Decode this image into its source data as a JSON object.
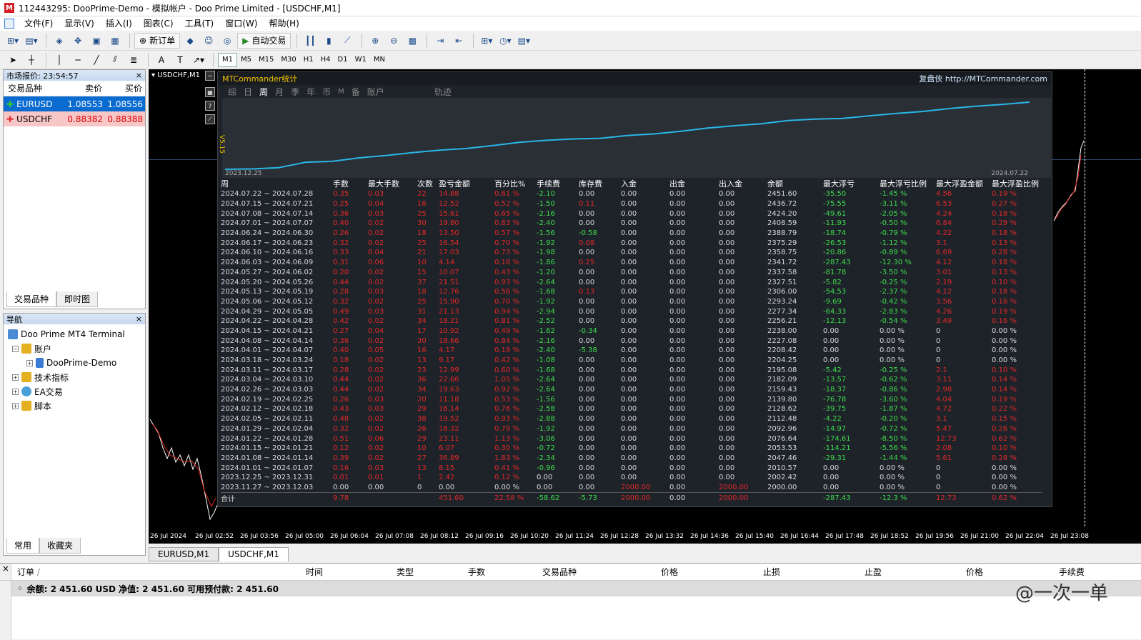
{
  "window": {
    "title": "112443295: DooPrime-Demo - 模拟帐户 - Doo Prime Limited - [USDCHF,M1]"
  },
  "menu": [
    "文件(F)",
    "显示(V)",
    "插入(I)",
    "图表(C)",
    "工具(T)",
    "窗口(W)",
    "帮助(H)"
  ],
  "toolbar": {
    "new_order": "新订单",
    "auto_trading": "自动交易"
  },
  "timeframes": [
    "M1",
    "M5",
    "M15",
    "M30",
    "H1",
    "H4",
    "D1",
    "W1",
    "MN"
  ],
  "market_watch": {
    "title": "市场报价: 23:54:57",
    "columns": [
      "交易品种",
      "卖价",
      "买价"
    ],
    "rows": [
      {
        "symbol": "EURUSD",
        "bid": "1.08553",
        "ask": "1.08556"
      },
      {
        "symbol": "USDCHF",
        "bid": "0.88382",
        "ask": "0.88388"
      }
    ],
    "tabs": [
      "交易品种",
      "即时图"
    ]
  },
  "navigator": {
    "title": "导航",
    "items": [
      "Doo Prime MT4 Terminal",
      "账户",
      "DooPrime-Demo",
      "技术指标",
      "EA交易",
      "脚本"
    ],
    "tabs": [
      "常用",
      "收藏夹"
    ]
  },
  "chart": {
    "label": "USDCHF,M1",
    "time_axis": [
      "26 Jul 2024",
      "26 Jul 02:52",
      "26 Jul 03:56",
      "26 Jul 05:00",
      "26 Jul 06:04",
      "26 Jul 07:08",
      "26 Jul 08:12",
      "26 Jul 09:16",
      "26 Jul 10:20",
      "26 Jul 11:24",
      "26 Jul 12:28",
      "26 Jul 13:32",
      "26 Jul 14:36",
      "26 Jul 15:40",
      "26 Jul 16:44",
      "26 Jul 17:48",
      "26 Jul 18:52",
      "26 Jul 19:56",
      "26 Jul 21:00",
      "26 Jul 22:04",
      "26 Jul 23:08"
    ],
    "tabs": [
      "EURUSD,M1",
      "USDCHF,M1"
    ]
  },
  "mtc": {
    "title": "MTCommander统计",
    "brand": "复盘侠 http://MTCommander.com",
    "version": "V5.15",
    "tabs": [
      "综",
      "日",
      "周",
      "月",
      "季",
      "年",
      "币",
      "M",
      "备",
      "账户",
      "轨迹"
    ],
    "graph_start": "2023.12.25",
    "graph_end": "2024.07.22",
    "columns": [
      "周",
      "手数",
      "最大手数",
      "次数",
      "盈亏金额",
      "百分比%",
      "手续费",
      "库存费",
      "入金",
      "出金",
      "出入金",
      "余额",
      "最大浮亏",
      "最大浮亏比例",
      "最大浮盈金额",
      "最大浮盈比例"
    ],
    "rows": [
      [
        "2024.07.22 ~ 2024.07.28",
        "0.35",
        "0.03",
        "22",
        "14.88",
        "0.61 %",
        "-2.10",
        "0.00",
        "0.00",
        "0.00",
        "0.00",
        "2451.60",
        "-35.50",
        "-1.45 %",
        "4.56",
        "0.19 %"
      ],
      [
        "2024.07.15 ~ 2024.07.21",
        "0.25",
        "0.04",
        "16",
        "12.52",
        "0.52 %",
        "-1.50",
        "0.11",
        "0.00",
        "0.00",
        "0.00",
        "2436.72",
        "-75.55",
        "-3.11 %",
        "6.53",
        "0.27 %"
      ],
      [
        "2024.07.08 ~ 2024.07.14",
        "0.36",
        "0.03",
        "25",
        "15.61",
        "0.65 %",
        "-2.16",
        "0.00",
        "0.00",
        "0.00",
        "0.00",
        "2424.20",
        "-49.61",
        "-2.05 %",
        "4.24",
        "0.18 %"
      ],
      [
        "2024.07.01 ~ 2024.07.07",
        "0.40",
        "0.02",
        "30",
        "19.80",
        "0.83 %",
        "-2.40",
        "0.00",
        "0.00",
        "0.00",
        "0.00",
        "2408.59",
        "-11.93",
        "-0.50 %",
        "6.84",
        "0.29 %"
      ],
      [
        "2024.06.24 ~ 2024.06.30",
        "0.26",
        "0.02",
        "18",
        "13.50",
        "0.57 %",
        "-1.56",
        "-0.58",
        "0.00",
        "0.00",
        "0.00",
        "2388.79",
        "-18.74",
        "-0.79 %",
        "4.22",
        "0.18 %"
      ],
      [
        "2024.06.17 ~ 2024.06.23",
        "0.32",
        "0.02",
        "25",
        "16.54",
        "0.70 %",
        "-1.92",
        "0.08",
        "0.00",
        "0.00",
        "0.00",
        "2375.29",
        "-26.53",
        "-1.12 %",
        "3.1",
        "0.13 %"
      ],
      [
        "2024.06.10 ~ 2024.06.16",
        "0.33",
        "0.04",
        "21",
        "17.03",
        "0.73 %",
        "-1.98",
        "0.00",
        "0.00",
        "0.00",
        "0.00",
        "2358.75",
        "-20.86",
        "-0.89 %",
        "6.69",
        "0.28 %"
      ],
      [
        "2024.06.03 ~ 2024.06.09",
        "0.31",
        "0.06",
        "10",
        "4.14",
        "0.18 %",
        "-1.86",
        "0.25",
        "0.00",
        "0.00",
        "0.00",
        "2341.72",
        "-287.43",
        "-12.30 %",
        "4.12",
        "0.18 %"
      ],
      [
        "2024.05.27 ~ 2024.06.02",
        "0.20",
        "0.02",
        "15",
        "10.07",
        "0.43 %",
        "-1.20",
        "0.00",
        "0.00",
        "0.00",
        "0.00",
        "2337.58",
        "-81.78",
        "-3.50 %",
        "3.01",
        "0.13 %"
      ],
      [
        "2024.05.20 ~ 2024.05.26",
        "0.44",
        "0.02",
        "37",
        "21.51",
        "0.93 %",
        "-2.64",
        "0.00",
        "0.00",
        "0.00",
        "0.00",
        "2327.51",
        "-5.82",
        "-0.25 %",
        "2.19",
        "0.10 %"
      ],
      [
        "2024.05.13 ~ 2024.05.19",
        "0.28",
        "0.03",
        "18",
        "12.76",
        "0.56 %",
        "-1.68",
        "0.13",
        "0.00",
        "0.00",
        "0.00",
        "2306.00",
        "-54.53",
        "-2.37 %",
        "4.12",
        "0.18 %"
      ],
      [
        "2024.05.06 ~ 2024.05.12",
        "0.32",
        "0.02",
        "25",
        "15.90",
        "0.70 %",
        "-1.92",
        "0.00",
        "0.00",
        "0.00",
        "0.00",
        "2293.24",
        "-9.69",
        "-0.42 %",
        "3.56",
        "0.16 %"
      ],
      [
        "2024.04.29 ~ 2024.05.05",
        "0.49",
        "0.03",
        "31",
        "21.13",
        "0.94 %",
        "-2.94",
        "0.00",
        "0.00",
        "0.00",
        "0.00",
        "2277.34",
        "-64.33",
        "-2.83 %",
        "4.26",
        "0.19 %"
      ],
      [
        "2024.04.22 ~ 2024.04.28",
        "0.42",
        "0.02",
        "34",
        "18.21",
        "0.81 %",
        "-2.52",
        "0.00",
        "0.00",
        "0.00",
        "0.00",
        "2256.21",
        "-12.13",
        "-0.54 %",
        "3.49",
        "0.16 %"
      ],
      [
        "2024.04.15 ~ 2024.04.21",
        "0.27",
        "0.04",
        "17",
        "10.92",
        "0.49 %",
        "-1.62",
        "-0.34",
        "0.00",
        "0.00",
        "0.00",
        "2238.00",
        "0.00",
        "0.00 %",
        "0",
        "0.00 %"
      ],
      [
        "2024.04.08 ~ 2024.04.14",
        "0.36",
        "0.02",
        "30",
        "18.66",
        "0.84 %",
        "-2.16",
        "0.00",
        "0.00",
        "0.00",
        "0.00",
        "2227.08",
        "0.00",
        "0.00 %",
        "0",
        "0.00 %"
      ],
      [
        "2024.04.01 ~ 2024.04.07",
        "0.40",
        "0.05",
        "16",
        "4.17",
        "0.19 %",
        "-2.40",
        "-5.38",
        "0.00",
        "0.00",
        "0.00",
        "2208.42",
        "0.00",
        "0.00 %",
        "0",
        "0.00 %"
      ],
      [
        "2024.03.18 ~ 2024.03.24",
        "0.18",
        "0.02",
        "13",
        "9.17",
        "0.42 %",
        "-1.08",
        "0.00",
        "0.00",
        "0.00",
        "0.00",
        "2204.25",
        "0.00",
        "0.00 %",
        "0",
        "0.00 %"
      ],
      [
        "2024.03.11 ~ 2024.03.17",
        "0.28",
        "0.02",
        "23",
        "12.99",
        "0.60 %",
        "-1.68",
        "0.00",
        "0.00",
        "0.00",
        "0.00",
        "2195.08",
        "-5.42",
        "-0.25 %",
        "2.1",
        "0.10 %"
      ],
      [
        "2024.03.04 ~ 2024.03.10",
        "0.44",
        "0.02",
        "36",
        "22.66",
        "1.05 %",
        "-2.64",
        "0.00",
        "0.00",
        "0.00",
        "0.00",
        "2182.09",
        "-13.57",
        "-0.62 %",
        "3.11",
        "0.14 %"
      ],
      [
        "2024.02.26 ~ 2024.03.03",
        "0.44",
        "0.02",
        "34",
        "19.63",
        "0.92 %",
        "-2.64",
        "0.00",
        "0.00",
        "0.00",
        "0.00",
        "2159.43",
        "-18.37",
        "-0.86 %",
        "2.98",
        "0.14 %"
      ],
      [
        "2024.02.19 ~ 2024.02.25",
        "0.26",
        "0.03",
        "20",
        "11.18",
        "0.53 %",
        "-1.56",
        "0.00",
        "0.00",
        "0.00",
        "0.00",
        "2139.80",
        "-76.78",
        "-3.60 %",
        "4.04",
        "0.19 %"
      ],
      [
        "2024.02.12 ~ 2024.02.18",
        "0.43",
        "0.03",
        "29",
        "16.14",
        "0.76 %",
        "-2.58",
        "0.00",
        "0.00",
        "0.00",
        "0.00",
        "2128.62",
        "-39.75",
        "-1.87 %",
        "4.72",
        "0.22 %"
      ],
      [
        "2024.02.05 ~ 2024.02.11",
        "0.48",
        "0.02",
        "38",
        "19.52",
        "0.93 %",
        "-2.88",
        "0.00",
        "0.00",
        "0.00",
        "0.00",
        "2112.48",
        "-4.22",
        "-0.20 %",
        "3.1",
        "0.15 %"
      ],
      [
        "2024.01.29 ~ 2024.02.04",
        "0.32",
        "0.02",
        "26",
        "16.32",
        "0.79 %",
        "-1.92",
        "0.00",
        "0.00",
        "0.00",
        "0.00",
        "2092.96",
        "-14.97",
        "-0.72 %",
        "5.47",
        "0.26 %"
      ],
      [
        "2024.01.22 ~ 2024.01.28",
        "0.51",
        "0.06",
        "29",
        "23.11",
        "1.13 %",
        "-3.06",
        "0.00",
        "0.00",
        "0.00",
        "0.00",
        "2076.64",
        "-174.61",
        "-8.50 %",
        "12.73",
        "0.62 %"
      ],
      [
        "2024.01.15 ~ 2024.01.21",
        "0.12",
        "0.02",
        "10",
        "6.07",
        "0.30 %",
        "-0.72",
        "0.00",
        "0.00",
        "0.00",
        "0.00",
        "2053.53",
        "-114.21",
        "-5.56 %",
        "2.08",
        "0.10 %"
      ],
      [
        "2024.01.08 ~ 2024.01.14",
        "0.39",
        "0.02",
        "27",
        "36.89",
        "1.83 %",
        "-2.34",
        "0.00",
        "0.00",
        "0.00",
        "0.00",
        "2047.46",
        "-29.31",
        "-1.44 %",
        "5.61",
        "0.28 %"
      ],
      [
        "2024.01.01 ~ 2024.01.07",
        "0.16",
        "0.03",
        "13",
        "8.15",
        "0.41 %",
        "-0.96",
        "0.00",
        "0.00",
        "0.00",
        "0.00",
        "2010.57",
        "0.00",
        "0.00 %",
        "0",
        "0.00 %"
      ],
      [
        "2023.12.25 ~ 2023.12.31",
        "0.01",
        "0.01",
        "1",
        "2.42",
        "0.12 %",
        "0.00",
        "0.00",
        "0.00",
        "0.00",
        "0.00",
        "2002.42",
        "0.00",
        "0.00 %",
        "0",
        "0.00 %"
      ],
      [
        "2023.11.27 ~ 2023.12.03",
        "0.00",
        "0.00",
        "0",
        "0.00",
        "0.00 %",
        "0.00",
        "0.00",
        "2000.00",
        "0.00",
        "2000.00",
        "2000.00",
        "0.00",
        "0.00 %",
        "0",
        "0.00 %"
      ]
    ],
    "total": [
      "合计",
      "9.78",
      "",
      "",
      "451.60",
      "22.58 %",
      "-58.62",
      "-5.73",
      "2000.00",
      "0.00",
      "2000.00",
      "",
      "-287.43",
      "-12.3 %",
      "12.73",
      "0.62 %"
    ]
  },
  "terminal": {
    "columns": [
      "订单",
      "时间",
      "类型",
      "手数",
      "交易品种",
      "价格",
      "止损",
      "止盈",
      "价格",
      "手续费"
    ],
    "balance": "余额: 2 451.60 USD  净值: 2 451.60  可用预付款: 2 451.60"
  },
  "watermark": "@一次一单"
}
